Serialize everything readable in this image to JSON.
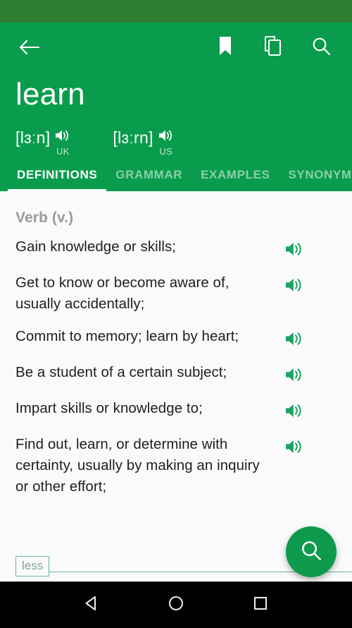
{
  "status_bar": {
    "color": "#2E7D32"
  },
  "app_bar": {
    "color": "#0A9C4D",
    "back_label": "Back",
    "actions": [
      {
        "name": "bookmark-icon",
        "label": "Bookmark"
      },
      {
        "name": "copy-icon",
        "label": "Copy"
      },
      {
        "name": "search-icon",
        "label": "Search"
      }
    ]
  },
  "entry": {
    "headword": "learn",
    "pronunciations": [
      {
        "ipa": "[lɜːn]",
        "region": "UK"
      },
      {
        "ipa": "[lɜːrn]",
        "region": "US"
      }
    ]
  },
  "tabs": [
    {
      "label": "DEFINITIONS",
      "active": true
    },
    {
      "label": "GRAMMAR",
      "active": false
    },
    {
      "label": "EXAMPLES",
      "active": false
    },
    {
      "label": "SYNONYM",
      "active": false
    }
  ],
  "definitions": {
    "part_of_speech": "Verb (v.)",
    "speaker_color": "#19A463",
    "items": [
      {
        "text": "Gain knowledge or skills;"
      },
      {
        "text": "Get to know or become aware of, usually accidentally;"
      },
      {
        "text": "Commit to memory; learn by heart;"
      },
      {
        "text": "Be a student of a certain subject;"
      },
      {
        "text": "Impart skills or knowledge to;"
      },
      {
        "text": "Find out, learn, or determine with certainty, usually by making an inquiry or other effort;"
      }
    ]
  },
  "expander": {
    "label": "less",
    "accent": "#66BB93"
  },
  "fab": {
    "name": "search-fab",
    "color": "#0D9A4D"
  },
  "nav_bar": {
    "buttons": [
      {
        "name": "android-back-icon",
        "label": "Back"
      },
      {
        "name": "android-home-icon",
        "label": "Home"
      },
      {
        "name": "android-recents-icon",
        "label": "Recents"
      }
    ]
  }
}
